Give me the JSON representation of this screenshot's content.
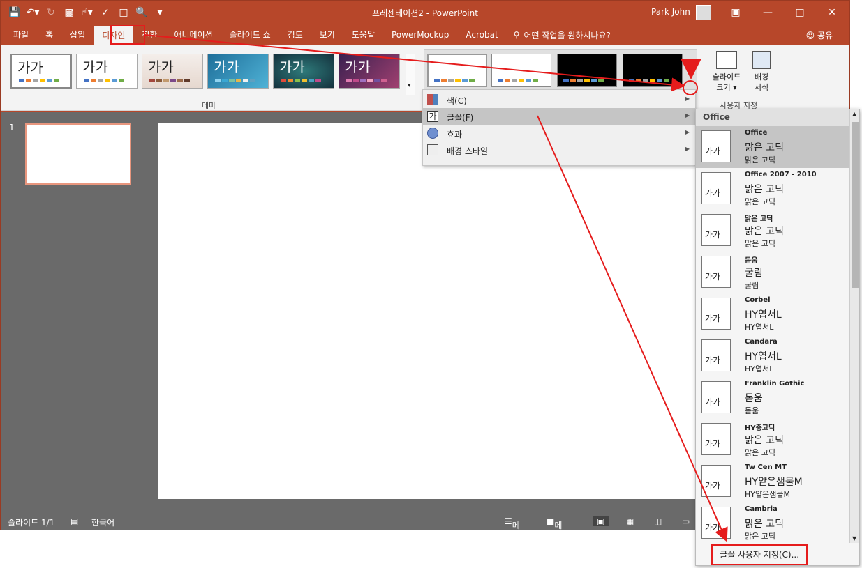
{
  "titlebar": {
    "title": "프레젠테이션2  -  PowerPoint",
    "user": "Park John"
  },
  "tabs": [
    "파일",
    "홈",
    "삽입",
    "디자인",
    "전환",
    "애니메이션",
    "슬라이드 쇼",
    "검토",
    "보기",
    "도움말",
    "PowerMockup",
    "Acrobat"
  ],
  "tell_me": "어떤 작업을 원하시나요?",
  "share": "공유",
  "themes": {
    "sample": "가가",
    "group_label": "테마"
  },
  "customize_group": {
    "slide_size": "슬라이드\n크기",
    "format_bg": "배경\n서식",
    "group_label": "사용자 지정"
  },
  "variant_menu": [
    {
      "label": "색(C)",
      "icon": "palette-icon"
    },
    {
      "label": "글꼴(F)",
      "icon": "font-icon"
    },
    {
      "label": "효과",
      "icon": "effects-icon"
    },
    {
      "label": "배경 스타일",
      "icon": "background-style-icon"
    }
  ],
  "font_panel": {
    "header": "Office",
    "fonts": [
      {
        "name": "Office",
        "heading": "맑은 고딕",
        "body": "맑은 고딕"
      },
      {
        "name": "Office 2007 - 2010",
        "heading": "맑은 고딕",
        "body": "맑은 고딕"
      },
      {
        "name": "맑은 고딕",
        "heading": "맑은 고딕",
        "body": "맑은 고딕"
      },
      {
        "name": "돋움",
        "heading": "굴림",
        "body": "굴림"
      },
      {
        "name": "Corbel",
        "heading": "HY엽서L",
        "body": "HY엽서L"
      },
      {
        "name": "Candara",
        "heading": "HY엽서L",
        "body": "HY엽서L"
      },
      {
        "name": "Franklin Gothic",
        "heading": "돋움",
        "body": "돋움"
      },
      {
        "name": "HY중고딕",
        "heading": "맑은 고딕",
        "body": "맑은 고딕"
      },
      {
        "name": "Tw Cen MT",
        "heading": "HY얕은샘물M",
        "body": "HY얕은샘물M"
      },
      {
        "name": "Cambria",
        "heading": "맑은 고딕",
        "body": "맑은 고딕"
      }
    ],
    "thumb_label": "가가",
    "customize": "글꼴 사용자 지정(C)..."
  },
  "slide_number": "1",
  "status": {
    "slide": "슬라이드 1/1",
    "language": "한국어",
    "notes": "메모",
    "comments": "메모"
  },
  "colors": {
    "accent": "#b7472a",
    "annotation": "#e51c1c"
  }
}
